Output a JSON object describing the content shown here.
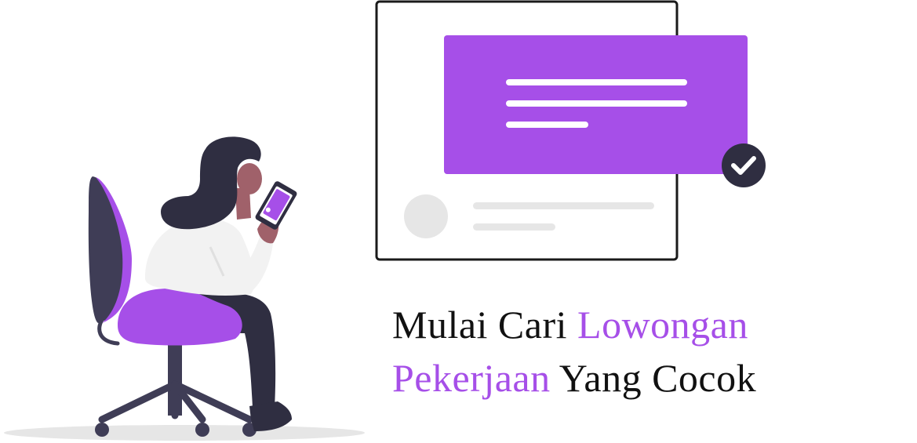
{
  "headline": {
    "line1_plain": "Mulai Cari ",
    "line1_accent": "Lowongan",
    "line2_accent": "Pekerjaan",
    "line2_plain": " Yang Cocok"
  },
  "colors": {
    "accent": "#a64fe8",
    "dark": "#2f2e41",
    "card_border": "#1a1a1a",
    "placeholder_gray": "#e6e6e6",
    "shirt": "#f2f2f2",
    "skin": "#a0616a"
  },
  "icons": {
    "check_badge": "check-circle-icon"
  }
}
